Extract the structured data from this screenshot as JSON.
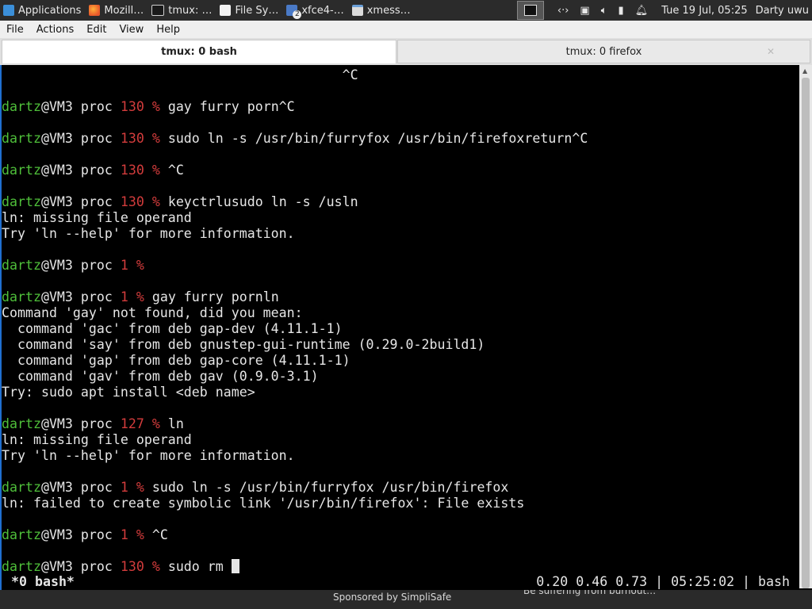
{
  "panel": {
    "apps": [
      {
        "label": "Applications",
        "icon": "xfce-mouse-icon"
      },
      {
        "label": "Mozill…",
        "icon": "firefox-icon"
      },
      {
        "label": "tmux: …",
        "icon": "terminal-icon"
      },
      {
        "label": "File Sy…",
        "icon": "file-icon"
      },
      {
        "label": "xfce4-…",
        "icon": "dots-icon",
        "badge": "2"
      },
      {
        "label": "xmess…",
        "icon": "window-icon"
      }
    ],
    "clock": "Tue 19 Jul, 05:25",
    "user": "Darty uwu",
    "tray_icons": [
      "workspace-icon",
      "network-icon",
      "display-icon",
      "volume-icon",
      "battery-icon",
      "bell-icon"
    ]
  },
  "menubar": {
    "items": [
      "File",
      "Actions",
      "Edit",
      "View",
      "Help"
    ]
  },
  "tabs": [
    {
      "label": "tmux: 0 bash",
      "active": true
    },
    {
      "label": "tmux: 0 firefox",
      "active": false
    }
  ],
  "terminal": {
    "user": "dartz",
    "host": "@VM3 proc ",
    "lines": [
      {
        "type": "out",
        "text": "                                           ^C"
      },
      {
        "type": "blank"
      },
      {
        "type": "prompt",
        "code": "130",
        "cmd": "gay furry porn^C"
      },
      {
        "type": "blank"
      },
      {
        "type": "prompt",
        "code": "130",
        "cmd": "sudo ln -s /usr/bin/furryfox /usr/bin/firefoxreturn^C"
      },
      {
        "type": "blank"
      },
      {
        "type": "prompt",
        "code": "130",
        "cmd": "^C"
      },
      {
        "type": "blank"
      },
      {
        "type": "prompt",
        "code": "130",
        "cmd": "keyctrlusudo ln -s /usln"
      },
      {
        "type": "out",
        "text": "ln: missing file operand"
      },
      {
        "type": "out",
        "text": "Try 'ln --help' for more information."
      },
      {
        "type": "blank"
      },
      {
        "type": "prompt",
        "code": "1",
        "cmd": ""
      },
      {
        "type": "blank"
      },
      {
        "type": "prompt",
        "code": "1",
        "cmd": "gay furry pornln"
      },
      {
        "type": "out",
        "text": "Command 'gay' not found, did you mean:"
      },
      {
        "type": "out",
        "text": "  command 'gac' from deb gap-dev (4.11.1-1)"
      },
      {
        "type": "out",
        "text": "  command 'say' from deb gnustep-gui-runtime (0.29.0-2build1)"
      },
      {
        "type": "out",
        "text": "  command 'gap' from deb gap-core (4.11.1-1)"
      },
      {
        "type": "out",
        "text": "  command 'gav' from deb gav (0.9.0-3.1)"
      },
      {
        "type": "out",
        "text": "Try: sudo apt install <deb name>"
      },
      {
        "type": "blank"
      },
      {
        "type": "prompt",
        "code": "127",
        "cmd": "ln"
      },
      {
        "type": "out",
        "text": "ln: missing file operand"
      },
      {
        "type": "out",
        "text": "Try 'ln --help' for more information."
      },
      {
        "type": "blank"
      },
      {
        "type": "prompt",
        "code": "1",
        "cmd": "sudo ln -s /usr/bin/furryfox /usr/bin/firefox"
      },
      {
        "type": "out",
        "text": "ln: failed to create symbolic link '/usr/bin/firefox': File exists"
      },
      {
        "type": "blank"
      },
      {
        "type": "prompt",
        "code": "1",
        "cmd": "^C"
      },
      {
        "type": "blank"
      },
      {
        "type": "prompt",
        "code": "130",
        "cmd": "sudo rm ",
        "cursor": true
      }
    ]
  },
  "status": {
    "left": "*0 bash*",
    "right": "0.20 0.46 0.73 | 05:25:02 | bash"
  },
  "bottom": {
    "sponsor": "Sponsored by SimpliSafe",
    "ticker": "Be suffering from burnout…"
  },
  "colors": {
    "user": "#4fbf3a",
    "exit_code": "#d33c3c",
    "active_border": "#1f6fd0"
  }
}
